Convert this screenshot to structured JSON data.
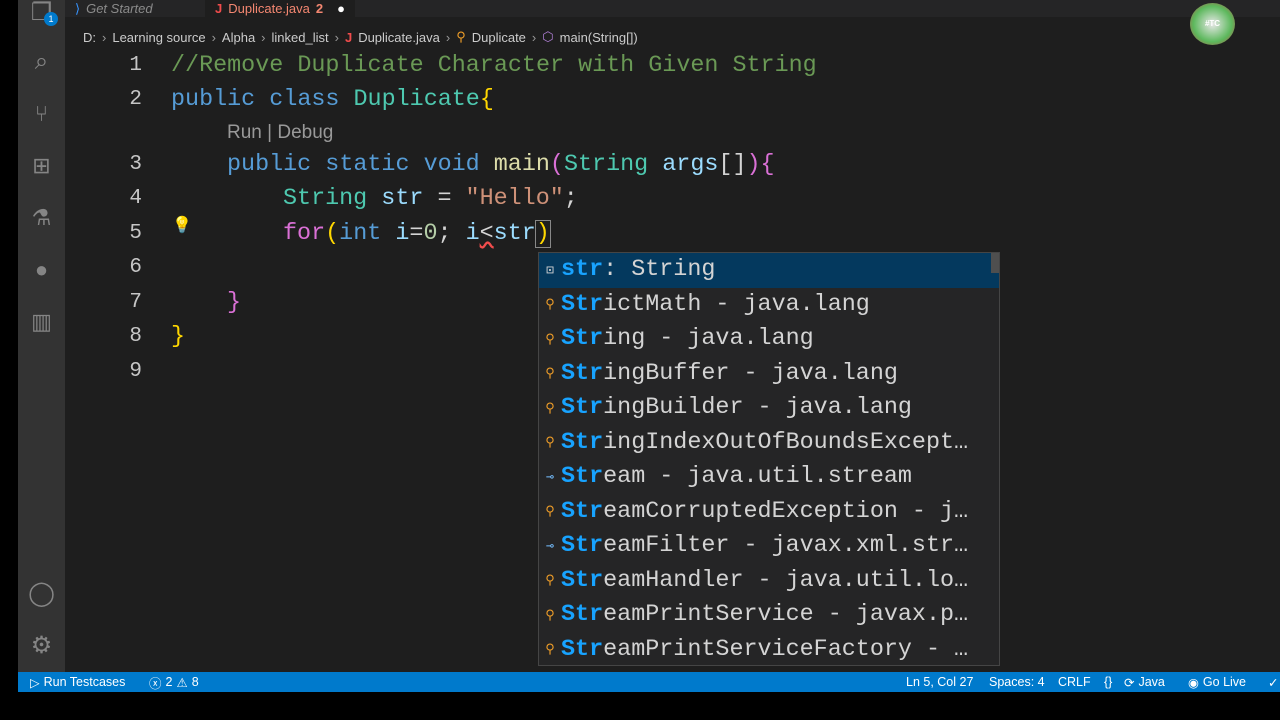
{
  "tabs": [
    {
      "label": "Get Started",
      "icon": "vscode-icon"
    },
    {
      "label": "Duplicate.java",
      "badge": "2",
      "icon": "java-icon",
      "modified": true
    }
  ],
  "breadcrumb": [
    "D:",
    "Learning source",
    "Alpha",
    "linked_list",
    "Duplicate.java",
    "Duplicate",
    "main(String[])"
  ],
  "activity": {
    "explorer_badge": "1"
  },
  "codelens": "Run | Debug",
  "lines": [
    "1",
    "2",
    "3",
    "4",
    "5",
    "6",
    "7",
    "8",
    "9"
  ],
  "code": {
    "l1": "//Remove Duplicate Character with Given String",
    "l2a": "public",
    "l2b": "class",
    "l2c": "Duplicate",
    "l2d": "{",
    "l3a": "public",
    "l3b": "static",
    "l3c": "void",
    "l3d": "main",
    "l3e": "(",
    "l3f": "String",
    "l3g": "args",
    "l3h": "[]",
    "l3i": ")",
    "l3j": "{",
    "l4a": "String",
    "l4b": "str",
    "l4c": " = ",
    "l4d": "\"Hello\"",
    "l4e": ";",
    "l5a": "for",
    "l5b": "(",
    "l5c": "int",
    "l5d": "i",
    "l5e": "=",
    "l5f": "0",
    "l5g": "; ",
    "l5h": "i",
    "l5i": "<",
    "l5j": "str",
    "l5k": ")",
    "l7": "}",
    "l8": "}"
  },
  "suggestions": [
    {
      "match": "str",
      "rest": " : String",
      "icon": "field-icon"
    },
    {
      "match": "Str",
      "rest": "ictMath - java.lang",
      "icon": "class-icon"
    },
    {
      "match": "Str",
      "rest": "ing - java.lang",
      "icon": "class-icon"
    },
    {
      "match": "Str",
      "rest": "ingBuffer - java.lang",
      "icon": "class-icon"
    },
    {
      "match": "Str",
      "rest": "ingBuilder - java.lang",
      "icon": "class-icon"
    },
    {
      "match": "Str",
      "rest": "ingIndexOutOfBoundsExcept…",
      "icon": "class-icon"
    },
    {
      "match": "Str",
      "rest": "eam - java.util.stream",
      "icon": "interface-icon"
    },
    {
      "match": "Str",
      "rest": "eamCorruptedException - j…",
      "icon": "class-icon"
    },
    {
      "match": "Str",
      "rest": "eamFilter - javax.xml.str…",
      "icon": "interface-icon"
    },
    {
      "match": "Str",
      "rest": "eamHandler - java.util.lo…",
      "icon": "class-icon"
    },
    {
      "match": "Str",
      "rest": "eamPrintService - javax.p…",
      "icon": "class-icon"
    },
    {
      "match": "Str",
      "rest": "eamPrintServiceFactory - …",
      "icon": "class-icon"
    }
  ],
  "status": {
    "run": "Run Testcases",
    "errors": "2",
    "warnings": "8",
    "position": "Ln 5, Col 27",
    "spaces": "Spaces: 4",
    "eol": "CRLF",
    "braces": "{}",
    "language": "Java",
    "golive": "Go Live"
  },
  "logo": "Tech Coder"
}
